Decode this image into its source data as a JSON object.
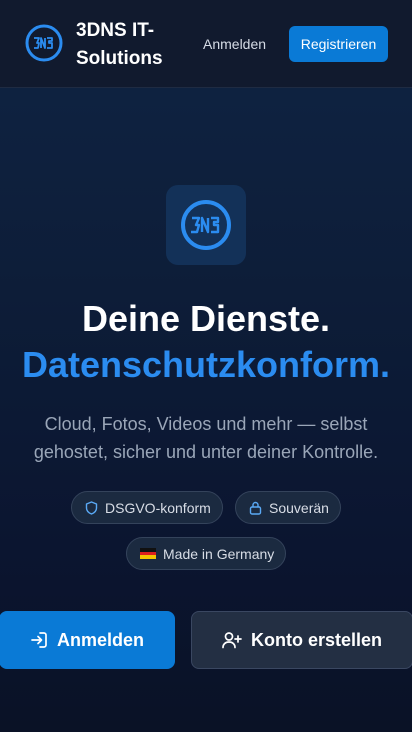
{
  "header": {
    "brand_name": "3DNS IT-Solutions",
    "login_label": "Anmelden",
    "register_label": "Registrieren"
  },
  "hero": {
    "headline_line1": "Deine Dienste.",
    "headline_line2": "Datenschutzkonform.",
    "subtitle": "Cloud, Fotos, Videos und mehr — selbst gehostet, sicher und unter deiner Kontrolle.",
    "badges": [
      {
        "label": "DSGVO-konform",
        "icon": "shield-icon"
      },
      {
        "label": "Souverän",
        "icon": "lock-icon"
      },
      {
        "label": "Made in Germany",
        "icon": "germany-flag-icon"
      }
    ],
    "primary_button_label": "Anmelden",
    "secondary_button_label": "Konto erstellen"
  },
  "colors": {
    "accent": "#0a7ad6",
    "headline_highlight": "#2b8cf0",
    "header_bg": "#111a2e",
    "page_bg": "#0d1d38"
  }
}
